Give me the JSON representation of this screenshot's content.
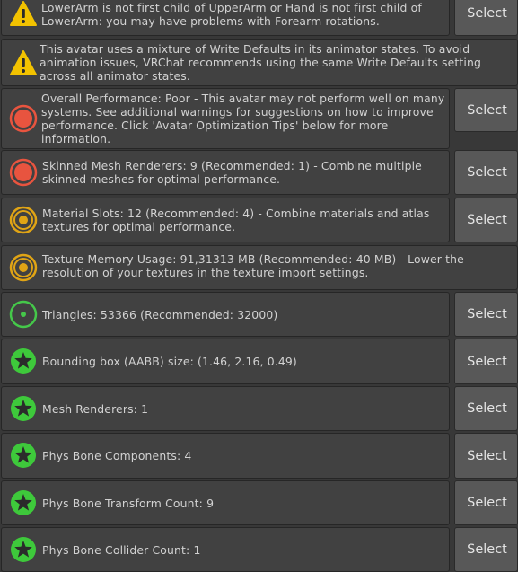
{
  "messages": [
    {
      "id": "lowerarm",
      "text": "LowerArm is not first child of UpperArm or Hand is not first child of LowerArm: you may have problems with Forearm rotations.",
      "icon": "warning-icon",
      "has_select": true
    },
    {
      "id": "write-defaults",
      "text": "This avatar uses a mixture of Write Defaults in its animator states. To avoid animation issues, VRChat recommends using the same Write Defaults setting across all animator states.",
      "icon": "warning-icon",
      "has_select": false
    },
    {
      "id": "overall",
      "text": "Overall Performance: Poor - This avatar may not perform well on many systems. See additional warnings for suggestions on how to improve performance. Click 'Avatar Optimization Tips' below for more information.",
      "icon": "poor-icon",
      "has_select": true
    },
    {
      "id": "skinned",
      "text": "Skinned Mesh Renderers: 9 (Recommended: 1) - Combine multiple skinned meshes for optimal performance.",
      "icon": "poor-icon",
      "has_select": true
    },
    {
      "id": "material",
      "text": "Material Slots: 12 (Recommended: 4) - Combine materials and atlas textures for optimal performance.",
      "icon": "medium-icon",
      "has_select": true
    },
    {
      "id": "texture",
      "text": "Texture Memory Usage: 91,31313 MB (Recommended: 40 MB) - Lower the resolution of your textures in the texture import settings.",
      "icon": "medium-icon",
      "has_select": false
    },
    {
      "id": "triangles",
      "text": "Triangles: 53366 (Recommended: 32000)",
      "icon": "good-icon",
      "has_select": true
    },
    {
      "id": "bounds",
      "text": "Bounding box (AABB) size: (1.46, 2.16, 0.49)",
      "icon": "excellent-icon",
      "has_select": true
    },
    {
      "id": "mesh",
      "text": "Mesh Renderers: 1",
      "icon": "excellent-icon",
      "has_select": true
    },
    {
      "id": "physbone",
      "text": "Phys Bone Components: 4",
      "icon": "excellent-icon",
      "has_select": true
    },
    {
      "id": "transforms",
      "text": "Phys Bone Transform Count: 9",
      "icon": "excellent-icon",
      "has_select": true
    },
    {
      "id": "colliders",
      "text": "Phys Bone Collider Count: 1",
      "icon": "excellent-icon",
      "has_select": true
    }
  ],
  "select_label": "Select",
  "colors": {
    "warning": "#f2c200",
    "poor": "#e8543f",
    "medium": "#e0a415",
    "good": "#45c84a",
    "excellent": "#3ec93b"
  }
}
